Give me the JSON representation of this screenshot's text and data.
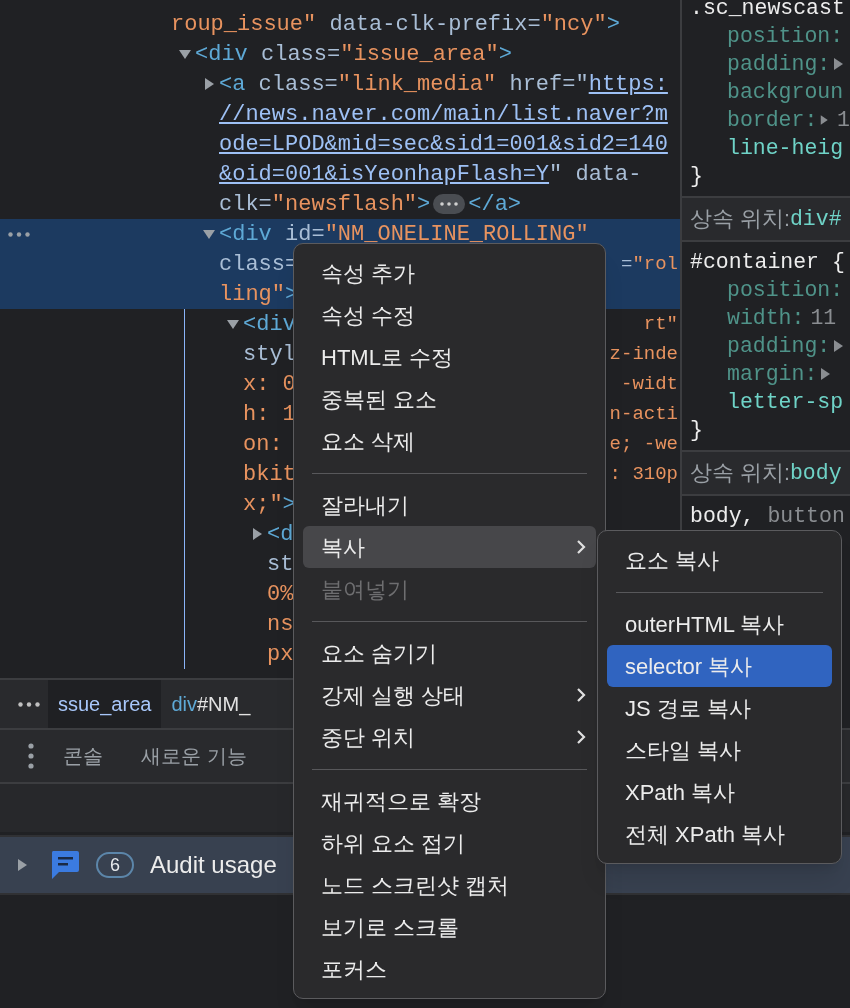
{
  "dom_tree": {
    "selected": false,
    "lines": [
      {
        "segments": [
          {
            "kind": "value",
            "text": "roup_issue\""
          },
          {
            "kind": "attr",
            "text": " data-clk-prefix="
          },
          {
            "kind": "value",
            "text": "\"ncy\""
          },
          {
            "kind": "tag",
            "text": ">"
          }
        ]
      }
    ],
    "children": [
      {
        "expanded": true,
        "selected": false,
        "lines": [
          {
            "segments": [
              {
                "kind": "tag",
                "text": "<div"
              },
              {
                "kind": "attr",
                "text": " class="
              },
              {
                "kind": "value",
                "text": "\"issue_area\""
              },
              {
                "kind": "tag",
                "text": ">"
              }
            ]
          }
        ],
        "children": [
          {
            "expanded": false,
            "selected": false,
            "badge": true,
            "lines": [
              {
                "segments": [
                  {
                    "kind": "tag",
                    "text": "<a"
                  },
                  {
                    "kind": "attr",
                    "text": " class="
                  },
                  {
                    "kind": "value",
                    "text": "\"link_media\""
                  },
                  {
                    "kind": "attr",
                    "text": " href=\""
                  },
                  {
                    "kind": "link",
                    "text": "https:"
                  }
                ]
              },
              {
                "segments": [
                  {
                    "kind": "link",
                    "text": "//news.naver.com/main/list.naver?m"
                  }
                ]
              },
              {
                "segments": [
                  {
                    "kind": "link",
                    "text": "ode=LPOD&mid=sec&sid1=001&sid2=140"
                  }
                ]
              },
              {
                "segments": [
                  {
                    "kind": "link",
                    "text": "&oid=001&isYeonhapFlash=Y"
                  },
                  {
                    "kind": "attr",
                    "text": "\" data-"
                  }
                ]
              },
              {
                "segments": [
                  {
                    "kind": "attr",
                    "text": "clk="
                  },
                  {
                    "kind": "value",
                    "text": "\"newsflash\""
                  },
                  {
                    "kind": "tag",
                    "text": ">"
                  }
                ]
              }
            ],
            "closing": [
              {
                "kind": "tag",
                "text": "</a>"
              }
            ]
          },
          {
            "expanded": true,
            "selected": true,
            "lines": [
              {
                "segments": [
                  {
                    "kind": "tag",
                    "text": "<div"
                  },
                  {
                    "kind": "attr",
                    "text": " id="
                  },
                  {
                    "kind": "value",
                    "text": "\"NM_ONELINE_ROLLING\""
                  }
                ]
              },
              {
                "segments": [
                  {
                    "kind": "attr",
                    "text": "class="
                  }
                ],
                "right": [
                  {
                    "kind": "attr",
                    "text": "="
                  },
                  {
                    "kind": "value",
                    "text": "\"rol"
                  }
                ]
              },
              {
                "segments": [
                  {
                    "kind": "value",
                    "text": "ling\""
                  },
                  {
                    "kind": "tag",
                    "text": ">"
                  }
                ]
              }
            ],
            "children": [
              {
                "expanded": true,
                "selected": false,
                "lines": [
                  {
                    "segments": [
                      {
                        "kind": "tag",
                        "text": "<div"
                      }
                    ],
                    "right": [
                      {
                        "kind": "value",
                        "text": "rt\""
                      }
                    ]
                  },
                  {
                    "segments": [
                      {
                        "kind": "attr",
                        "text": "styl"
                      }
                    ],
                    "right": [
                      {
                        "kind": "value",
                        "text": "z-inde"
                      }
                    ]
                  },
                  {
                    "segments": [
                      {
                        "kind": "value",
                        "text": "x: 0"
                      }
                    ],
                    "right": [
                      {
                        "kind": "value",
                        "text": "-widt"
                      }
                    ]
                  },
                  {
                    "segments": [
                      {
                        "kind": "value",
                        "text": "h: 1"
                      }
                    ],
                    "right": [
                      {
                        "kind": "value",
                        "text": "n-acti"
                      }
                    ]
                  },
                  {
                    "segments": [
                      {
                        "kind": "value",
                        "text": "on:"
                      }
                    ],
                    "right": [
                      {
                        "kind": "value",
                        "text": "e; -we"
                      }
                    ]
                  },
                  {
                    "segments": [
                      {
                        "kind": "value",
                        "text": "bkit"
                      }
                    ],
                    "right": [
                      {
                        "kind": "value",
                        "text": ": 310p"
                      }
                    ]
                  },
                  {
                    "segments": [
                      {
                        "kind": "value",
                        "text": "x;\""
                      },
                      {
                        "kind": "tag",
                        "text": ">"
                      }
                    ]
                  }
                ],
                "children": [
                  {
                    "expanded": false,
                    "selected": false,
                    "lines": [
                      {
                        "segments": [
                          {
                            "kind": "tag",
                            "text": "<d"
                          }
                        ]
                      },
                      {
                        "segments": [
                          {
                            "kind": "attr",
                            "text": "st"
                          }
                        ]
                      },
                      {
                        "segments": [
                          {
                            "kind": "value",
                            "text": "0%"
                          }
                        ]
                      },
                      {
                        "segments": [
                          {
                            "kind": "value",
                            "text": "ns"
                          }
                        ]
                      },
                      {
                        "segments": [
                          {
                            "kind": "value",
                            "text": "px"
                          }
                        ]
                      }
                    ]
                  }
                ]
              }
            ]
          }
        ]
      }
    ]
  },
  "breadcrumbs": [
    {
      "text": "ssue_area",
      "selected": true
    },
    {
      "tag": "div",
      "text": "#NM_",
      "selected": false
    }
  ],
  "styles": {
    "sections": [
      {
        "selector": [
          {
            "text": ".sc_newscast",
            "dimmed": false
          }
        ],
        "properties": [
          {
            "name": "position:",
            "dimmed": true
          },
          {
            "name": "padding:",
            "dimmed": true,
            "expandable": true
          },
          {
            "name": "backgroun",
            "dimmed": true
          },
          {
            "name": "border:",
            "dimmed": true,
            "expandable": true,
            "value": "1"
          },
          {
            "name": "line-heig",
            "dimmed": false
          }
        ],
        "closing": "}"
      },
      {
        "header": {
          "label": "상속 위치:",
          "selector": "div#"
        },
        "selector": [
          {
            "text": "#container {",
            "dimmed": false
          }
        ],
        "properties": [
          {
            "name": "position:",
            "dimmed": true
          },
          {
            "name": "width:",
            "dimmed": true,
            "value": "11"
          },
          {
            "name": "padding:",
            "dimmed": true,
            "expandable": true
          },
          {
            "name": "margin:",
            "dimmed": true,
            "expandable": true
          },
          {
            "name": "letter-sp",
            "dimmed": false
          }
        ],
        "closing": "}"
      },
      {
        "header": {
          "label": "상속 위치:",
          "selector": "body"
        },
        "selector": [
          {
            "text": "body,",
            "dimmed": false
          },
          {
            "text": "button",
            "dimmed": true
          }
        ]
      }
    ]
  },
  "drawer": {
    "tabs": [
      {
        "label": "콘솔",
        "selected": false
      },
      {
        "label": "새로운 기능",
        "selected": false
      }
    ],
    "issue": {
      "expanded": false,
      "count": "6",
      "text": "Audit usage"
    }
  },
  "context_menu": {
    "items": [
      {
        "kind": "item",
        "label": "속성 추가",
        "selected": false,
        "disabled": false,
        "submenu": false
      },
      {
        "kind": "item",
        "label": "속성 수정",
        "selected": false,
        "disabled": false,
        "submenu": false
      },
      {
        "kind": "item",
        "label": "HTML로 수정",
        "selected": false,
        "disabled": false,
        "submenu": false
      },
      {
        "kind": "item",
        "label": "중복된 요소",
        "selected": false,
        "disabled": false,
        "submenu": false
      },
      {
        "kind": "item",
        "label": "요소 삭제",
        "selected": false,
        "disabled": false,
        "submenu": false
      },
      {
        "kind": "separator"
      },
      {
        "kind": "item",
        "label": "잘라내기",
        "selected": false,
        "disabled": false,
        "submenu": false
      },
      {
        "kind": "item",
        "label": "복사",
        "selected": true,
        "disabled": false,
        "submenu": true
      },
      {
        "kind": "item",
        "label": "붙여넣기",
        "selected": false,
        "disabled": true,
        "submenu": false
      },
      {
        "kind": "separator"
      },
      {
        "kind": "item",
        "label": "요소 숨기기",
        "selected": false,
        "disabled": false,
        "submenu": false
      },
      {
        "kind": "item",
        "label": "강제 실행 상태",
        "selected": false,
        "disabled": false,
        "submenu": true
      },
      {
        "kind": "item",
        "label": "중단 위치",
        "selected": false,
        "disabled": false,
        "submenu": true
      },
      {
        "kind": "separator"
      },
      {
        "kind": "item",
        "label": "재귀적으로 확장",
        "selected": false,
        "disabled": false,
        "submenu": false
      },
      {
        "kind": "item",
        "label": "하위 요소 접기",
        "selected": false,
        "disabled": false,
        "submenu": false
      },
      {
        "kind": "item",
        "label": "노드 스크린샷 캡처",
        "selected": false,
        "disabled": false,
        "submenu": false
      },
      {
        "kind": "item",
        "label": "보기로 스크롤",
        "selected": false,
        "disabled": false,
        "submenu": false
      },
      {
        "kind": "item",
        "label": "포커스",
        "selected": false,
        "disabled": false,
        "submenu": false
      }
    ]
  },
  "submenu": {
    "items": [
      {
        "kind": "item",
        "label": "요소 복사",
        "selected": false,
        "disabled": false,
        "submenu": false
      },
      {
        "kind": "separator"
      },
      {
        "kind": "item",
        "label": "outerHTML 복사",
        "selected": false,
        "disabled": false,
        "submenu": false
      },
      {
        "kind": "item",
        "label": "selector 복사",
        "selected": true,
        "disabled": false,
        "submenu": false
      },
      {
        "kind": "item",
        "label": "JS 경로 복사",
        "selected": false,
        "disabled": false,
        "submenu": false
      },
      {
        "kind": "item",
        "label": "스타일 복사",
        "selected": false,
        "disabled": false,
        "submenu": false
      },
      {
        "kind": "item",
        "label": "XPath 복사",
        "selected": false,
        "disabled": false,
        "submenu": false
      },
      {
        "kind": "item",
        "label": "전체 XPath 복사",
        "selected": false,
        "disabled": false,
        "submenu": false
      }
    ]
  }
}
